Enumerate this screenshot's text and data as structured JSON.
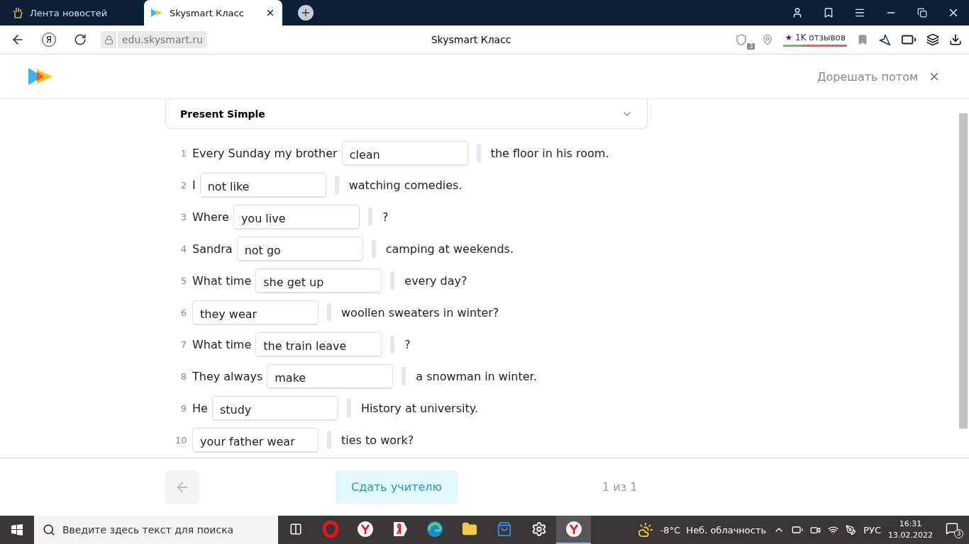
{
  "browser": {
    "tabs": [
      {
        "label": "Лента новостей",
        "selected": false
      },
      {
        "label": "Skysmart Класс",
        "selected": true
      }
    ],
    "address": {
      "yandex_key": "Я",
      "url": "edu.skysmart.ru",
      "page_title": "Skysmart Класс",
      "shield_count": "3",
      "reviews": "★ 1K отзывов"
    }
  },
  "header": {
    "later_link": "Дорешать потом"
  },
  "task": {
    "title": "Present Simple",
    "expanded": false,
    "rows": [
      {
        "number": "1",
        "before": "Every Sunday my brother",
        "answer": "clean",
        "after": "the floor in his room."
      },
      {
        "number": "2",
        "before": "I",
        "answer": "not like",
        "after": "watching comedies."
      },
      {
        "number": "3",
        "before": "Where",
        "answer": "you live",
        "after": "?"
      },
      {
        "number": "4",
        "before": "Sandra",
        "answer": "not go",
        "after": "camping at weekends."
      },
      {
        "number": "5",
        "before": "What time",
        "answer": "she get up",
        "after": "every day?"
      },
      {
        "number": "6",
        "before": "",
        "answer": "they wear",
        "after": "woollen sweaters in winter?"
      },
      {
        "number": "7",
        "before": "What time",
        "answer": "the train leave",
        "after": "?"
      },
      {
        "number": "8",
        "before": "They always",
        "answer": "make",
        "after": "a snowman in winter."
      },
      {
        "number": "9",
        "before": "He",
        "answer": "study",
        "after": "History at university."
      },
      {
        "number": "10",
        "before": "",
        "answer": "your father wear",
        "after": "ties to work?"
      }
    ]
  },
  "footer": {
    "submit": "Сдать учителю",
    "pages": "1 из 1"
  },
  "taskbar": {
    "search_placeholder": "Введите здесь текст для поиска",
    "apps": [
      {
        "kind": "taskview",
        "selected": false
      },
      {
        "kind": "opera",
        "selected": false
      },
      {
        "kind": "ybrowser",
        "selected": false
      },
      {
        "kind": "yandex",
        "selected": false
      },
      {
        "kind": "edge",
        "selected": false
      },
      {
        "kind": "folder",
        "selected": false
      },
      {
        "kind": "store",
        "selected": false
      },
      {
        "kind": "settings",
        "selected": false
      },
      {
        "kind": "ybrowser",
        "selected": true
      }
    ],
    "weather": "-8°C  Неб. облачность",
    "language": "РУС",
    "time": "16:31",
    "date": "13.02.2022",
    "notifications": "3"
  }
}
